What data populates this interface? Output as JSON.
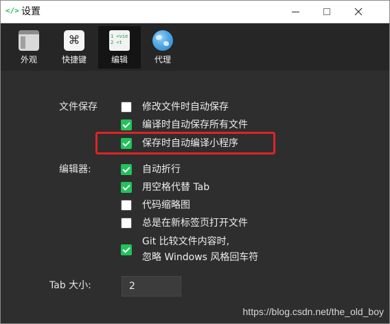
{
  "window": {
    "title": "设置",
    "app_icon": "</>",
    "close_glyph": "✕"
  },
  "toolbar": {
    "items": [
      {
        "label": "外观",
        "icon": "appearance-icon",
        "active": false
      },
      {
        "label": "快捷键",
        "icon": "command-key-icon",
        "glyph": "⌘",
        "active": false
      },
      {
        "label": "编辑",
        "icon": "code-editor-icon",
        "active": true,
        "code_lines": [
          "1 <vie",
          "2   <t"
        ]
      },
      {
        "label": "代理",
        "icon": "globe-icon",
        "active": false
      }
    ]
  },
  "file_save": {
    "label": "文件保存",
    "options": [
      {
        "label": "修改文件时自动保存",
        "checked": false
      },
      {
        "label": "编译时自动保存所有文件",
        "checked": true
      },
      {
        "label": "保存时自动编译小程序",
        "checked": true
      }
    ]
  },
  "editor": {
    "label": "编辑器:",
    "options": [
      {
        "label": "自动折行",
        "checked": true
      },
      {
        "label": "用空格代替 Tab",
        "checked": true
      },
      {
        "label": "代码缩略图",
        "checked": false
      },
      {
        "label": "总是在新标签页打开文件",
        "checked": false
      },
      {
        "label_line1": "Git 比较文件内容时,",
        "label_line2": "忽略 Windows 风格回车符",
        "checked": true
      }
    ]
  },
  "tab_size": {
    "label": "Tab 大小:",
    "value": "2"
  },
  "watermark": "https://blog.csdn.net/the_old_boy",
  "colors": {
    "accent_green": "#21c35a",
    "highlight_red": "#e02424",
    "panel_bg": "#2e2e2e"
  }
}
